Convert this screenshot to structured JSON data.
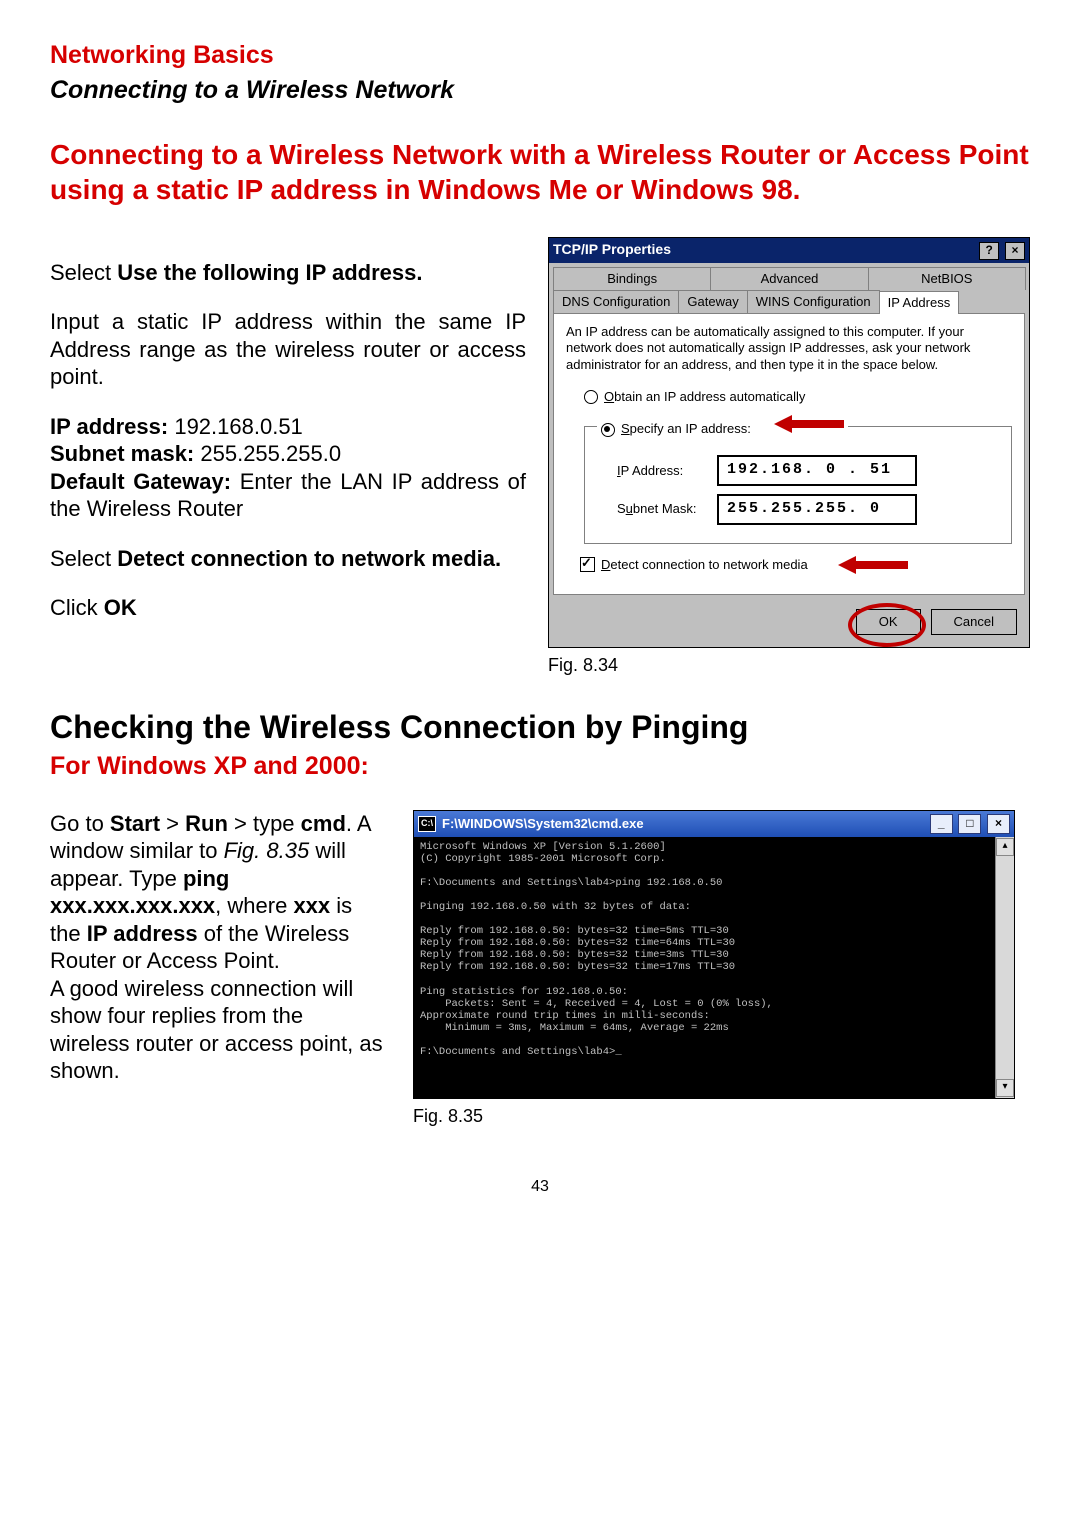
{
  "header": {
    "section": "Networking Basics",
    "subtitle": "Connecting to a Wireless Network"
  },
  "heading1": "Connecting to a Wireless Network with a Wireless Router or Access Point using a static IP address in Windows Me or Windows 98.",
  "left": {
    "p1a": "Select ",
    "p1b": "Use the following IP address.",
    "p2": "Input a static IP address within the same IP Address range as the wireless router or access point.",
    "ip_label": "IP address: ",
    "ip_value": "192.168.0.51",
    "sn_label": "Subnet mask: ",
    "sn_value": "255.255.255.0",
    "gw_label": "Default Gateway: ",
    "gw_text": "Enter the LAN IP address of the Wireless Router",
    "p3a": "Select ",
    "p3b": "Detect connection to network media.",
    "p4a": "Click ",
    "p4b": "OK"
  },
  "dialog": {
    "title": "TCP/IP Properties",
    "help": "?",
    "close": "×",
    "tabs_top": [
      "Bindings",
      "Advanced",
      "NetBIOS"
    ],
    "tabs_bottom": [
      "DNS Configuration",
      "Gateway",
      "WINS Configuration",
      "IP Address"
    ],
    "info": "An IP address can be automatically assigned to this computer. If your network does not automatically assign IP addresses, ask your network administrator for an address, and then type it in the space below.",
    "radio_auto": "Obtain an IP address automatically",
    "radio_specify": "Specify an IP address:",
    "field_ip_label": "IP Address:",
    "field_ip_value": "192.168. 0 . 51",
    "field_sn_label": "Subnet Mask:",
    "field_sn_value": "255.255.255. 0",
    "check_label": "Detect connection to network media",
    "ok": "OK",
    "cancel": "Cancel",
    "fig": "Fig. 8.34"
  },
  "heading2": "Checking the Wireless Connection by Pinging",
  "subheading2": "For Windows XP and 2000:",
  "left2": {
    "t1": "Go to ",
    "t2": "Start",
    "t3": " > ",
    "t4": "Run",
    "t5": " > type ",
    "t6": "cmd",
    "t7": ".  A window similar to ",
    "t8": "Fig. 8.35",
    "t9": " will appear.  Type ",
    "t10": "ping xxx.xxx.xxx.xxx",
    "t11": ", where ",
    "t12": "xxx",
    "t13": " is the ",
    "t14": "IP address",
    "t15": " of the Wireless Router or Access Point.",
    "t16": "A good wireless connection will show four replies from the wireless router or access point, as shown."
  },
  "cmd": {
    "title_icon": "C:\\",
    "title": "F:\\WINDOWS\\System32\\cmd.exe",
    "min": "_",
    "max": "□",
    "close": "×",
    "body": "Microsoft Windows XP [Version 5.1.2600]\n(C) Copyright 1985-2001 Microsoft Corp.\n\nF:\\Documents and Settings\\lab4>ping 192.168.0.50\n\nPinging 192.168.0.50 with 32 bytes of data:\n\nReply from 192.168.0.50: bytes=32 time=5ms TTL=30\nReply from 192.168.0.50: bytes=32 time=64ms TTL=30\nReply from 192.168.0.50: bytes=32 time=3ms TTL=30\nReply from 192.168.0.50: bytes=32 time=17ms TTL=30\n\nPing statistics for 192.168.0.50:\n    Packets: Sent = 4, Received = 4, Lost = 0 (0% loss),\nApproximate round trip times in milli-seconds:\n    Minimum = 3ms, Maximum = 64ms, Average = 22ms\n\nF:\\Documents and Settings\\lab4>_",
    "scroll_up": "▴",
    "scroll_down": "▾",
    "fig": "Fig. 8.35"
  },
  "page_num": "43"
}
